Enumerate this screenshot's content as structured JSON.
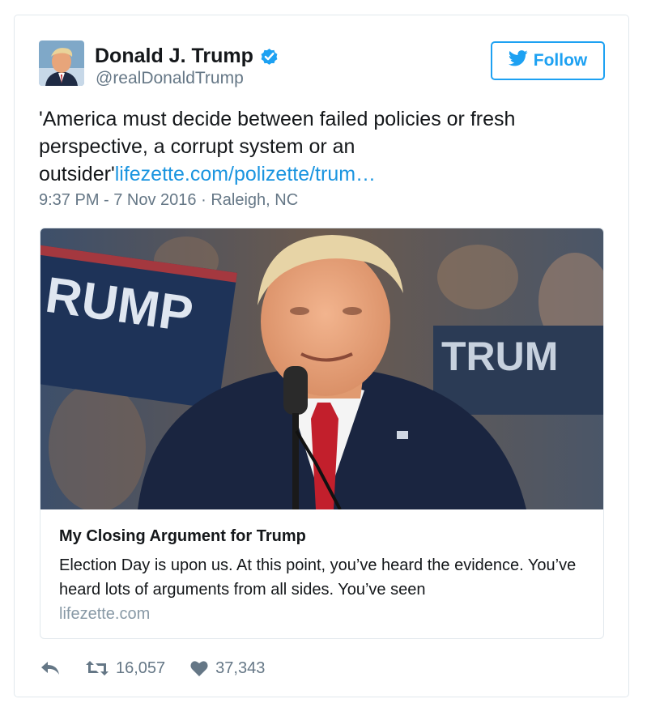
{
  "author": {
    "name": "Donald J. Trump",
    "handle": "@realDonaldTrump",
    "verified_icon": "verified-badge-icon"
  },
  "follow": {
    "label": "Follow",
    "icon": "twitter-bird-icon"
  },
  "tweet": {
    "text": "'America must decide between failed policies or fresh perspective, a corrupt system or an outsider'",
    "link": "lifezette.com/polizette/trum…",
    "meta": "9:37 PM - 7 Nov 2016 · Raleigh, NC"
  },
  "card": {
    "title": "My Closing Argument for Trump",
    "description": "Election Day is upon us. At this point, you’ve heard the evidence. You’ve heard lots of arguments from all sides. You’ve seen",
    "domain": "lifezette.com",
    "image_sign_left": "RUMP",
    "image_sign_right": "TRUM"
  },
  "actions": {
    "reply_icon": "reply-icon",
    "retweet_icon": "retweet-icon",
    "retweets": "16,057",
    "like_icon": "heart-icon",
    "likes": "37,343"
  },
  "colors": {
    "accent": "#1da1f2",
    "link": "#1b95e0",
    "secondary_text": "#657786",
    "border": "#e1e8ed"
  }
}
